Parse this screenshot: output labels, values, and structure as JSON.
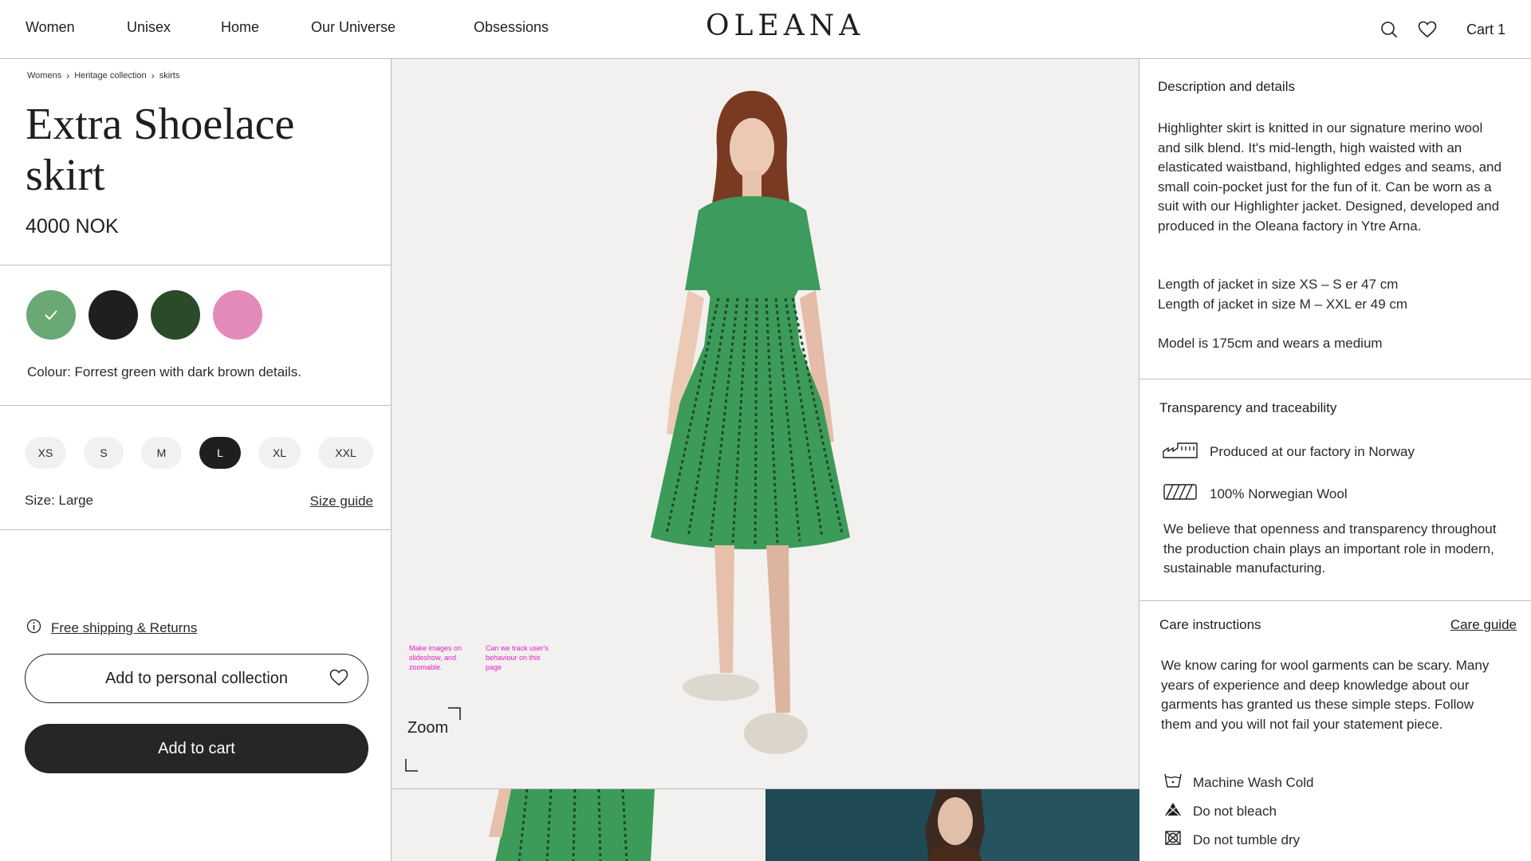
{
  "header": {
    "nav": [
      "Women",
      "Unisex",
      "Home",
      "Our Universe",
      "Obsessions"
    ],
    "logo": "OLEANA",
    "cart_label": "Cart 1",
    "icons": [
      "search-icon",
      "heart-icon"
    ]
  },
  "breadcrumb": [
    "Womens",
    "Heritage collection",
    "skirts"
  ],
  "product": {
    "title": "Extra Shoelace skirt",
    "price": "4000 NOK",
    "colours": [
      {
        "name": "forrest-green",
        "hex": "#6aa876",
        "selected": true
      },
      {
        "name": "black",
        "hex": "#1f1f1f",
        "selected": false
      },
      {
        "name": "dark-green",
        "hex": "#2a4a2a",
        "selected": false
      },
      {
        "name": "pink",
        "hex": "#e48ab8",
        "selected": false
      }
    ],
    "colour_label": "Colour: Forrest green with dark brown details.",
    "sizes": [
      "XS",
      "S",
      "M",
      "L",
      "XL",
      "XXL"
    ],
    "selected_size": "L",
    "size_label": "Size: Large",
    "size_guide": "Size guide"
  },
  "actions": {
    "shipping": "Free shipping & Returns",
    "add_collection": "Add to personal collection",
    "add_cart": "Add to cart"
  },
  "gallery": {
    "note1": "Make images on slideshow, and zoomable.",
    "note2": "Can we track user's behaviour on this page",
    "zoom": "Zoom"
  },
  "details": {
    "title": "Description and details",
    "description": "Highlighter skirt is knitted in our signature merino wool and silk blend. It's mid-length, high waisted with an elasticated waistband, highlighted edges and seams, and small coin-pocket just for the fun of it. Can be worn as a suit with our Highlighter jacket. Designed, developed and produced in the Oleana factory in Ytre Arna.",
    "length1": "Length of jacket in size  XS – S er 47 cm",
    "length2": "Length of jacket in size M – XXL er 49 cm",
    "model": "Model is 175cm and wears a medium"
  },
  "transparency": {
    "title": "Transparency and traceability",
    "factory": "Produced at our factory in Norway",
    "wool": "100% Norwegian Wool",
    "text": "We believe that openness and transparency throughout the production chain plays an important role in modern, sustainable manufacturing."
  },
  "care": {
    "title": "Care instructions",
    "guide": "Care guide",
    "text": "We know caring for wool garments can be scary. Many years of experience and deep knowledge about our garments has granted us these simple steps. Follow them and you will not fail your statement piece.",
    "items": [
      "Machine Wash Cold",
      "Do not bleach",
      "Do not tumble dry"
    ]
  }
}
